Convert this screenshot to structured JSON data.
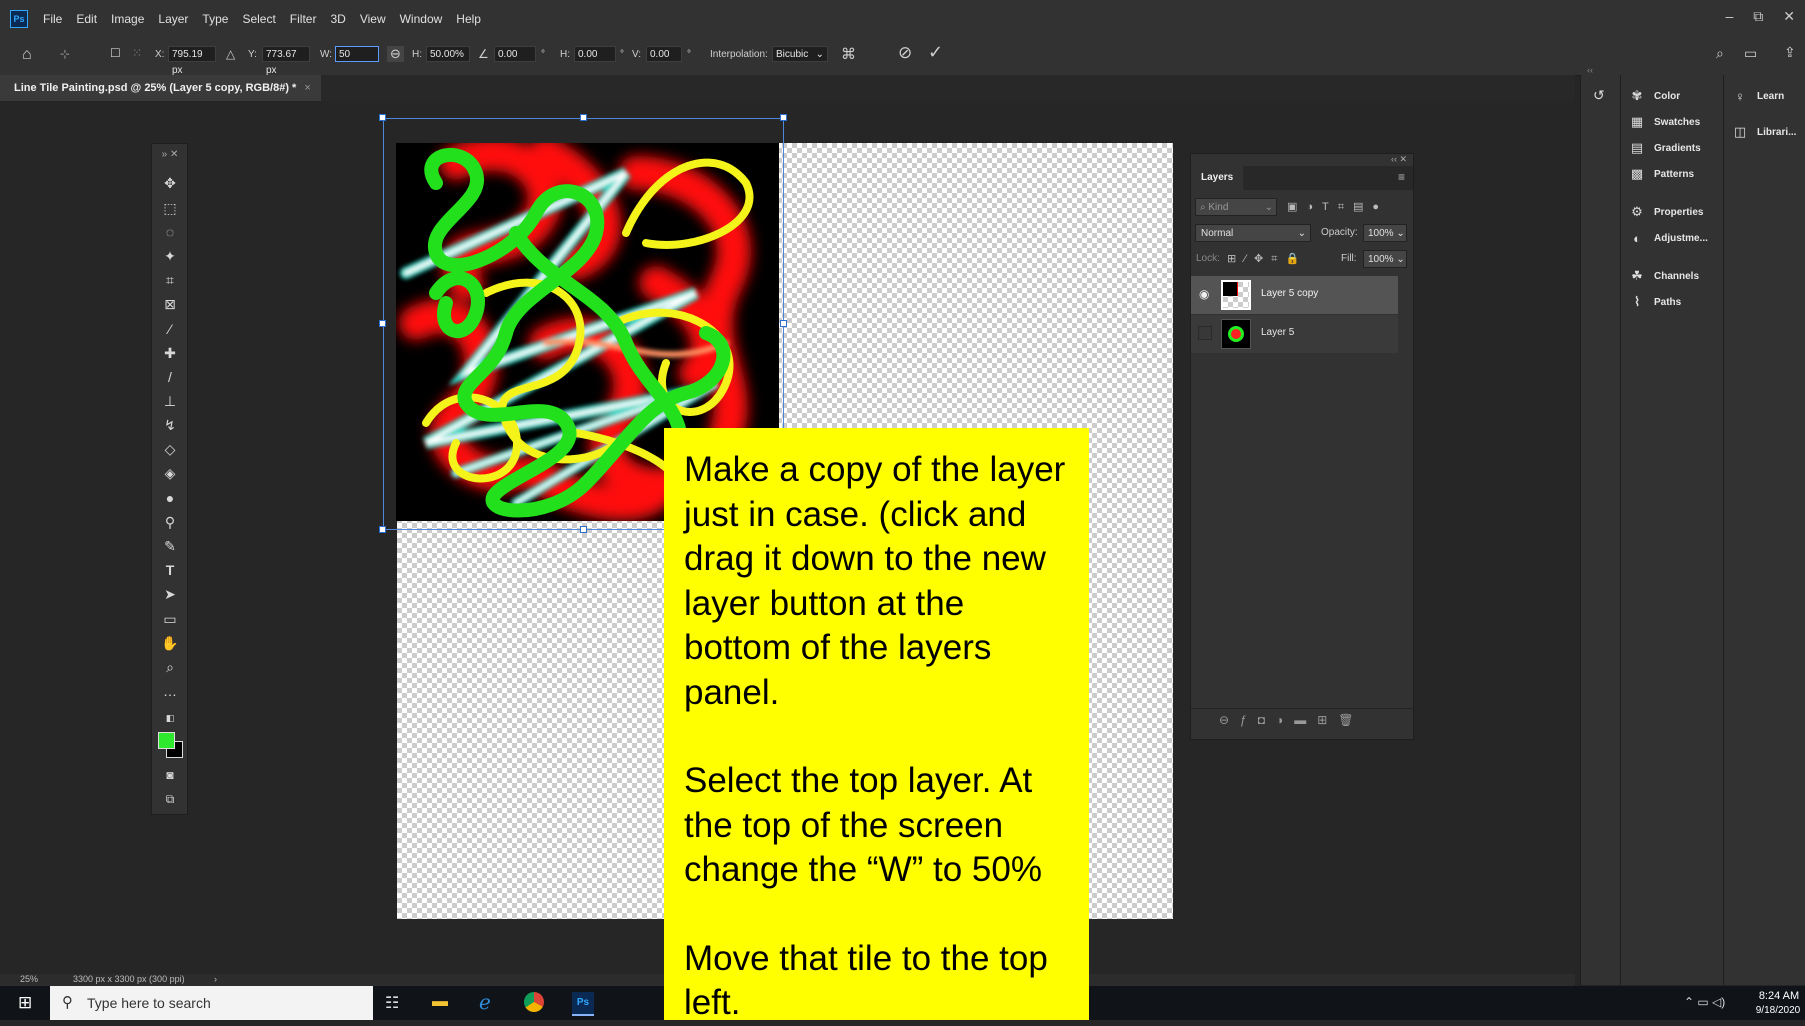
{
  "app": {
    "logo": "Ps",
    "menus": [
      "File",
      "Edit",
      "Image",
      "Layer",
      "Type",
      "Select",
      "Filter",
      "3D",
      "View",
      "Window",
      "Help"
    ],
    "window_controls": [
      "–",
      "⧉",
      "✕"
    ]
  },
  "options_bar": {
    "x_label": "X:",
    "x_value": "795.19 px",
    "y_label": "Y:",
    "y_value": "773.67 px",
    "w_label": "W:",
    "w_value": "50",
    "h_label": "H:",
    "h_value": "50.00%",
    "angle_value": "0.00",
    "hskew_label": "H:",
    "hskew_value": "0.00",
    "vskew_label": "V:",
    "vskew_value": "0.00",
    "degree": "°",
    "interp_label": "Interpolation:",
    "interp_value": "Bicubic"
  },
  "document_tab": {
    "title": "Line Tile Painting.psd @ 25% (Layer 5 copy, RGB/8#) *",
    "close": "×"
  },
  "layers_panel": {
    "tab": "Layers",
    "kind_placeholder": "Kind",
    "blend_mode": "Normal",
    "opacity_label": "Opacity:",
    "opacity_value": "100%",
    "lock_label": "Lock:",
    "fill_label": "Fill:",
    "fill_value": "100%",
    "layers": [
      {
        "name": "Layer 5 copy",
        "visible": true,
        "selected": true
      },
      {
        "name": "Layer 5",
        "visible": false,
        "selected": false
      }
    ]
  },
  "right_panels": {
    "column1": [
      {
        "label": "Color",
        "icon": "palette-icon"
      },
      {
        "label": "Swatches",
        "icon": "grid-icon"
      },
      {
        "label": "Gradients",
        "icon": "gradient-icon"
      },
      {
        "label": "Patterns",
        "icon": "pattern-icon"
      },
      {
        "label": "Properties",
        "icon": "properties-icon"
      },
      {
        "label": "Adjustme...",
        "icon": "adjustments-icon"
      },
      {
        "label": "Channels",
        "icon": "channels-icon"
      },
      {
        "label": "Paths",
        "icon": "paths-icon"
      }
    ],
    "column2": [
      {
        "label": "Learn",
        "icon": "lightbulb-icon"
      },
      {
        "label": "Librari...",
        "icon": "library-icon"
      }
    ]
  },
  "status_bar": {
    "zoom": "25%",
    "doc_info": "3300 px x 3300 px (300 ppi)",
    "arrow": "›"
  },
  "taskbar": {
    "search_placeholder": "Type here to search",
    "time": "8:24 AM",
    "date": "9/18/2020"
  },
  "instruction_note": {
    "paragraph1": "Make a copy of the layer just in case. (click and drag it down to the new layer button at the bottom of the layers panel.",
    "paragraph2": "Select the top layer. At the top of the screen change the “W” to 50%",
    "paragraph3": "Move that tile to the top left."
  },
  "colors": {
    "foreground": "#2ee82e",
    "background": "#000000",
    "selection": "#2a6fd0",
    "note": "#ffff00"
  }
}
